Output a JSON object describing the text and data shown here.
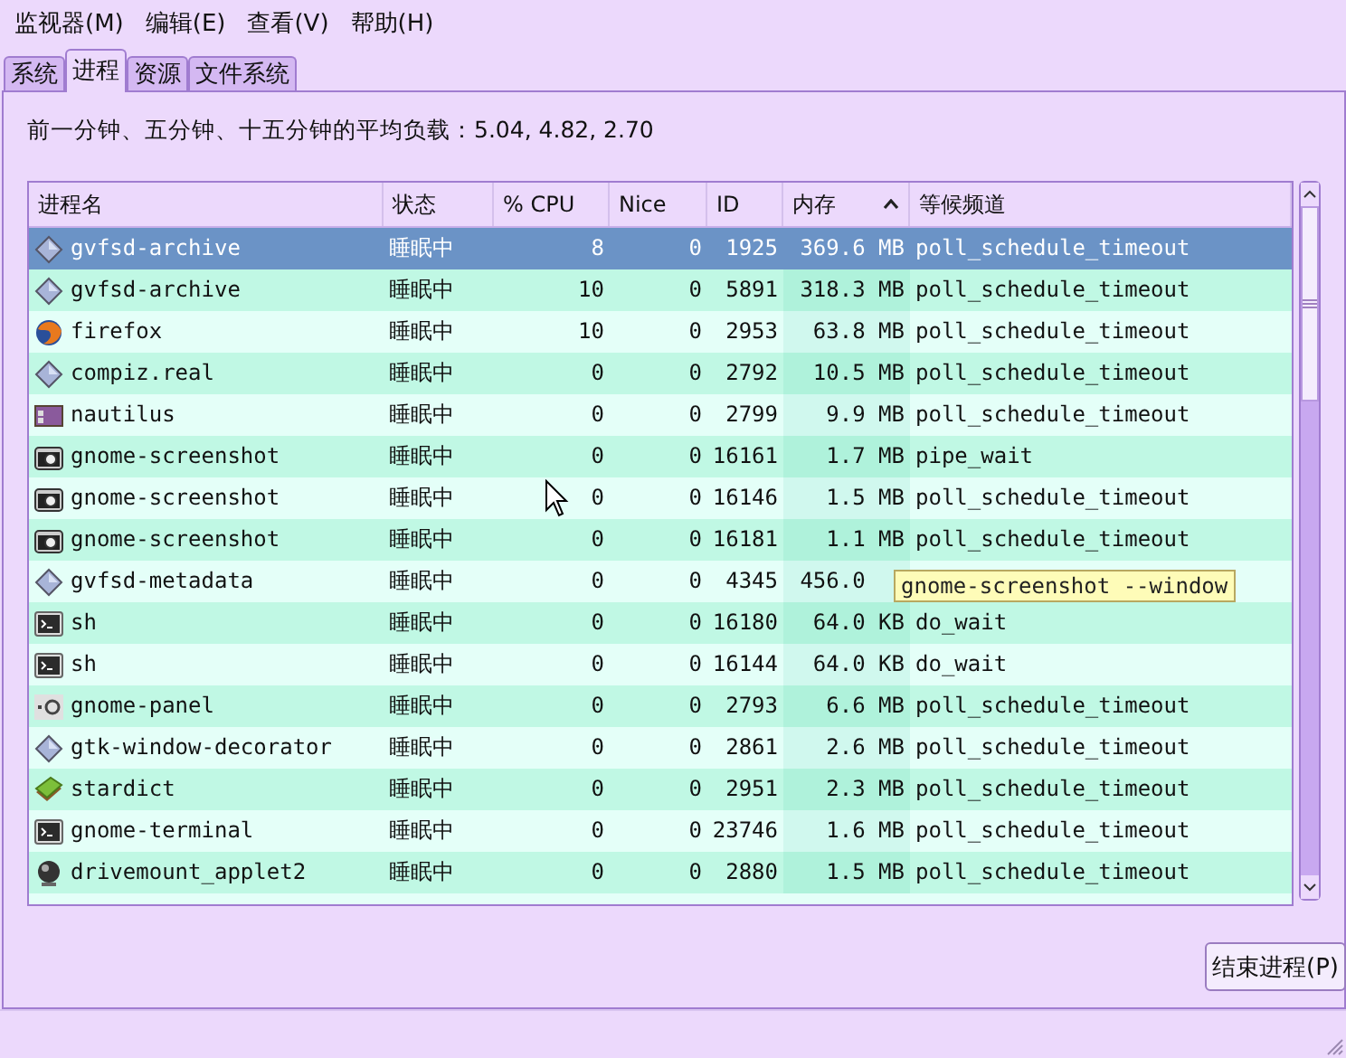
{
  "menu": [
    "监视器(M)",
    "编辑(E)",
    "查看(V)",
    "帮助(H)"
  ],
  "tabs": [
    {
      "label": "系统",
      "selected": false
    },
    {
      "label": "进程",
      "selected": true
    },
    {
      "label": "资源",
      "selected": false
    },
    {
      "label": "文件系统",
      "selected": false
    }
  ],
  "load_average": "前一分钟、五分钟、十五分钟的平均负载：5.04, 4.82, 2.70",
  "table": {
    "columns": [
      {
        "label": "进程名",
        "sorted": false
      },
      {
        "label": "状态",
        "sorted": false
      },
      {
        "label": "% CPU",
        "sorted": false
      },
      {
        "label": "Nice",
        "sorted": false
      },
      {
        "label": "ID",
        "sorted": false
      },
      {
        "label": "内存",
        "sorted": true
      },
      {
        "label": "等候频道",
        "sorted": false
      }
    ],
    "rows": [
      {
        "kind": "diamond",
        "name": "gvfsd-archive",
        "status": "睡眠中",
        "cpu": "8",
        "nice": "0",
        "id": "1925",
        "memory": "369.6 MB",
        "wait": "poll_schedule_timeout",
        "selected": true
      },
      {
        "kind": "diamond",
        "name": "gvfsd-archive",
        "status": "睡眠中",
        "cpu": "10",
        "nice": "0",
        "id": "5891",
        "memory": "318.3 MB",
        "wait": "poll_schedule_timeout",
        "selected": false
      },
      {
        "kind": "globe",
        "name": "firefox",
        "status": "睡眠中",
        "cpu": "10",
        "nice": "0",
        "id": "2953",
        "memory": "63.8 MB",
        "wait": "poll_schedule_timeout",
        "selected": false
      },
      {
        "kind": "diamond",
        "name": "compiz.real",
        "status": "睡眠中",
        "cpu": "0",
        "nice": "0",
        "id": "2792",
        "memory": "10.5 MB",
        "wait": "poll_schedule_timeout",
        "selected": false
      },
      {
        "kind": "folder",
        "name": "nautilus",
        "status": "睡眠中",
        "cpu": "0",
        "nice": "0",
        "id": "2799",
        "memory": "9.9 MB",
        "wait": "poll_schedule_timeout",
        "selected": false
      },
      {
        "kind": "camera",
        "name": "gnome-screenshot",
        "status": "睡眠中",
        "cpu": "0",
        "nice": "0",
        "id": "16161",
        "memory": "1.7 MB",
        "wait": "pipe_wait",
        "selected": false
      },
      {
        "kind": "camera",
        "name": "gnome-screenshot",
        "status": "睡眠中",
        "cpu": "0",
        "nice": "0",
        "id": "16146",
        "memory": "1.5 MB",
        "wait": "poll_schedule_timeout",
        "selected": false
      },
      {
        "kind": "camera",
        "name": "gnome-screenshot",
        "status": "睡眠中",
        "cpu": "0",
        "nice": "0",
        "id": "16181",
        "memory": "1.1 MB",
        "wait": "poll_schedule_timeout",
        "selected": false
      },
      {
        "kind": "diamond",
        "name": "gvfsd-metadata",
        "status": "睡眠中",
        "cpu": "0",
        "nice": "0",
        "id": "4345",
        "memory": "456.0",
        "selected": false
      },
      {
        "kind": "terminal",
        "name": "sh",
        "status": "睡眠中",
        "cpu": "0",
        "nice": "0",
        "id": "16180",
        "memory": "64.0 KB",
        "wait": "do_wait",
        "selected": false
      },
      {
        "kind": "terminal",
        "name": "sh",
        "status": "睡眠中",
        "cpu": "0",
        "nice": "0",
        "id": "16144",
        "memory": "64.0 KB",
        "wait": "do_wait",
        "selected": false
      },
      {
        "kind": "panel",
        "name": "gnome-panel",
        "status": "睡眠中",
        "cpu": "0",
        "nice": "0",
        "id": "2793",
        "memory": "6.6 MB",
        "wait": "poll_schedule_timeout",
        "selected": false
      },
      {
        "kind": "diamond",
        "name": "gtk-window-decorator",
        "status": "睡眠中",
        "cpu": "0",
        "nice": "0",
        "id": "2861",
        "memory": "2.6 MB",
        "wait": "poll_schedule_timeout",
        "selected": false
      },
      {
        "kind": "book",
        "name": "stardict",
        "status": "睡眠中",
        "cpu": "0",
        "nice": "0",
        "id": "2951",
        "memory": "2.3 MB",
        "wait": "poll_schedule_timeout",
        "selected": false
      },
      {
        "kind": "terminal",
        "name": "gnome-terminal",
        "status": "睡眠中",
        "cpu": "0",
        "nice": "0",
        "id": "23746",
        "memory": "1.6 MB",
        "wait": "poll_schedule_timeout",
        "selected": false
      },
      {
        "kind": "ball",
        "name": "drivemount_applet2",
        "status": "睡眠中",
        "cpu": "0",
        "nice": "0",
        "id": "2880",
        "memory": "1.5 MB",
        "wait": "poll_schedule_timeout",
        "selected": false
      }
    ]
  },
  "tooltip": "gnome-screenshot --window",
  "end_button": "结束进程(P)"
}
